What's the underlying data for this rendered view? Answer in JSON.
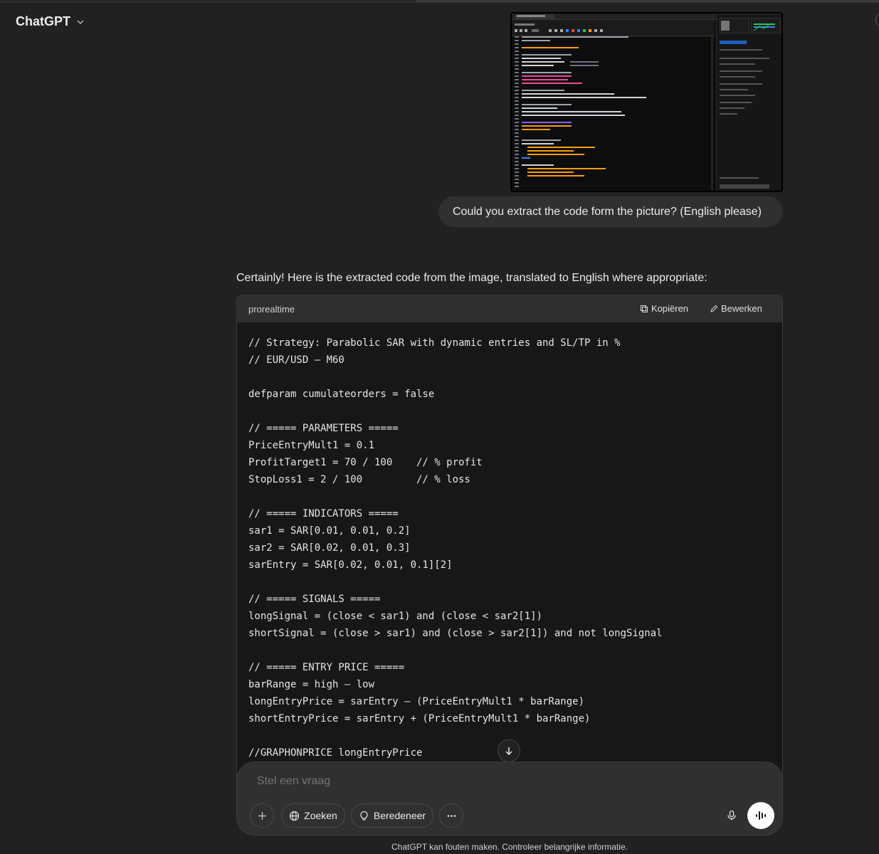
{
  "header": {
    "model_name": "ChatGPT"
  },
  "attachment": {
    "icon": "image-attachment"
  },
  "conversation": {
    "user_message": "Could you extract the code form the picture? (English please)",
    "assistant_intro": "Certainly! Here is the extracted code from the image, translated to English where appropriate:"
  },
  "code_block": {
    "language": "prorealtime",
    "copy_label": "Kopiëren",
    "edit_label": "Bewerken",
    "lines": [
      "// Strategy: Parabolic SAR with dynamic entries and SL/TP in %",
      "// EUR/USD – M60",
      "",
      "defparam cumulateorders = false",
      "",
      "// ===== PARAMETERS =====",
      "PriceEntryMult1 = 0.1",
      "ProfitTarget1 = 70 / 100    // % profit",
      "StopLoss1 = 2 / 100         // % loss",
      "",
      "// ===== INDICATORS =====",
      "sar1 = SAR[0.01, 0.01, 0.2]",
      "sar2 = SAR[0.02, 0.01, 0.3]",
      "sarEntry = SAR[0.02, 0.01, 0.1][2]",
      "",
      "// ===== SIGNALS =====",
      "longSignal = (close < sar1) and (close < sar2[1])",
      "shortSignal = (close > sar1) and (close > sar2[1]) and not longSignal",
      "",
      "// ===== ENTRY PRICE =====",
      "barRange = high – low",
      "longEntryPrice = sarEntry – (PriceEntryMult1 * barRange)",
      "shortEntryPrice = sarEntry + (PriceEntryMult1 * barRange)",
      "",
      "//GRAPHONPRICE longEntryPrice"
    ]
  },
  "composer": {
    "placeholder": "Stel een vraag",
    "search_label": "Zoeken",
    "reason_label": "Beredeneer"
  },
  "footer": {
    "disclaimer": "ChatGPT kan fouten maken. Controleer belangrijke informatie."
  },
  "colors": {
    "background": "#212121",
    "bubble": "#303030",
    "code_bg": "#171717",
    "accent_white": "#ffffff"
  }
}
